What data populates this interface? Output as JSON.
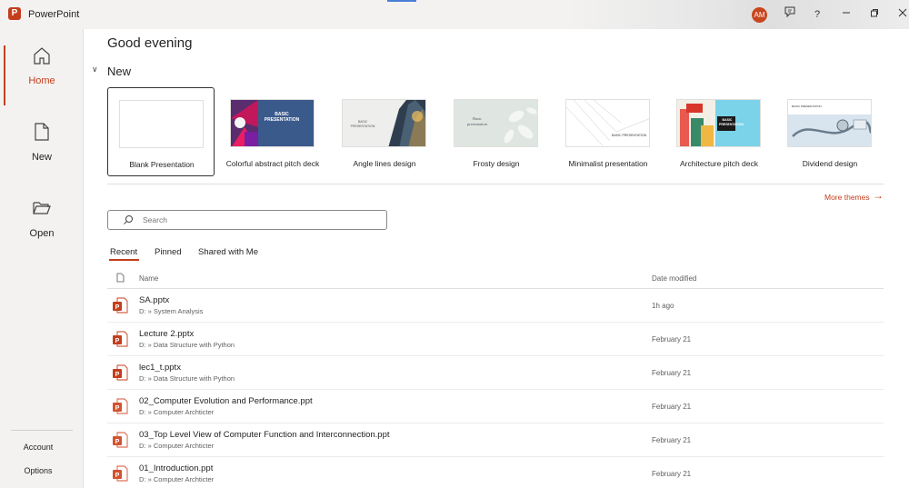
{
  "titlebar": {
    "app_name": "PowerPoint",
    "app_icon": "P",
    "avatar_initials": "AM"
  },
  "sidebar": {
    "home": "Home",
    "new": "New",
    "open": "Open",
    "account": "Account",
    "options": "Options"
  },
  "greeting": "Good evening",
  "new_section": {
    "title": "New",
    "more_themes": "More themes",
    "templates": [
      {
        "label": "Blank Presentation"
      },
      {
        "label": "Colorful abstract pitch deck",
        "thumb_text": "BASIC PRESENTATION"
      },
      {
        "label": "Angle lines design",
        "thumb_text": "BASIC PRESENTATION"
      },
      {
        "label": "Frosty design",
        "thumb_text": "Basic presentation"
      },
      {
        "label": "Minimalist presentation",
        "thumb_text": "BASIC PRESENTATION"
      },
      {
        "label": "Architecture pitch deck",
        "thumb_text": "BASIC PRESENTATION"
      },
      {
        "label": "Dividend design",
        "thumb_text": "BASIC PRESENTATION"
      }
    ]
  },
  "search": {
    "placeholder": "Search"
  },
  "tabs": {
    "recent": "Recent",
    "pinned": "Pinned",
    "shared": "Shared with Me"
  },
  "file_list": {
    "col_name": "Name",
    "col_date": "Date modified",
    "files": [
      {
        "name": "SA.pptx",
        "path": "D: » System Analysis",
        "date": "1h ago"
      },
      {
        "name": "Lecture 2.pptx",
        "path": "D: » Data Structure with Python",
        "date": "February 21"
      },
      {
        "name": "lec1_t.pptx",
        "path": "D: » Data Structure with Python",
        "date": "February 21"
      },
      {
        "name": "02_Computer Evolution and Performance.ppt",
        "path": "D: » Computer Archticter",
        "date": "February 21"
      },
      {
        "name": "03_Top Level View of Computer Function and Interconnection.ppt",
        "path": "D: » Computer Archticter",
        "date": "February 21"
      },
      {
        "name": "01_Introduction.ppt",
        "path": "D: » Computer Archticter",
        "date": "February 21"
      }
    ]
  },
  "colors": {
    "accent": "#c43e1c",
    "sidebar_bg": "#f3f2f1"
  }
}
